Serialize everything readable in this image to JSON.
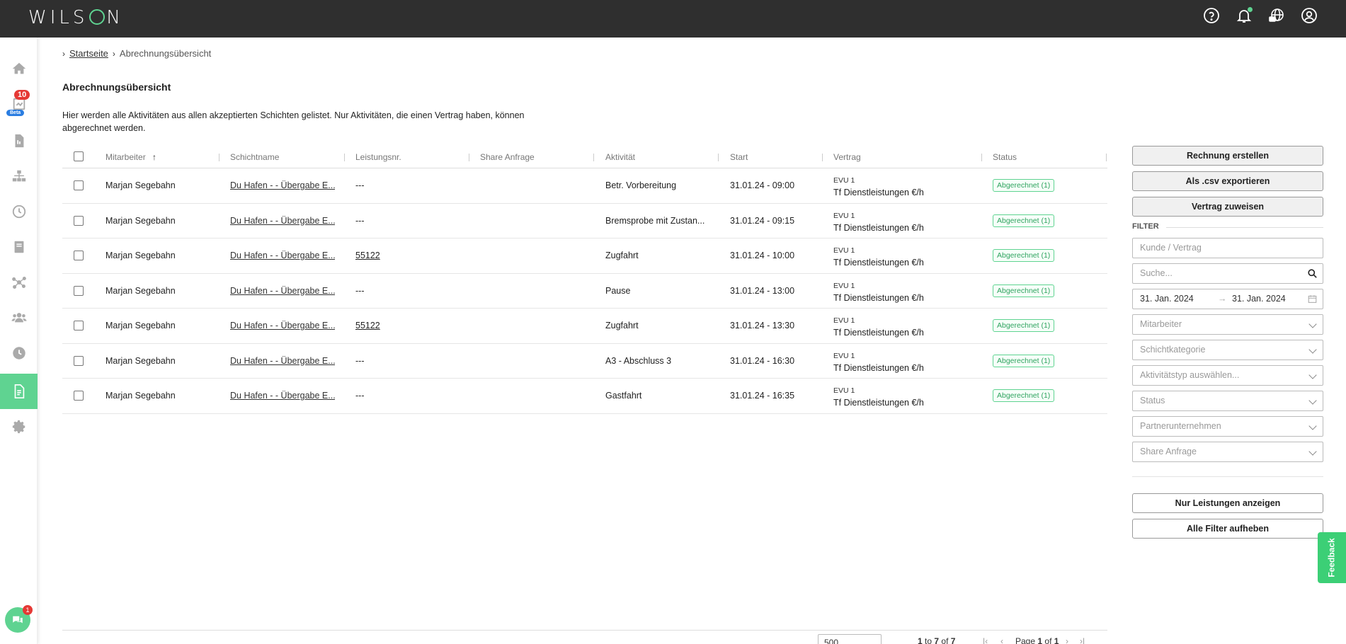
{
  "app": {
    "logo": "WILSON"
  },
  "topbar": {
    "icons": [
      "help-icon",
      "bell-icon",
      "globe-chat-icon",
      "user-account-icon"
    ]
  },
  "sidebar": {
    "items": [
      "home-icon",
      "report-icon",
      "document-icon",
      "hierarchy-icon",
      "clock-icon",
      "book-icon",
      "network-icon",
      "users-icon",
      "history-icon",
      "billing-icon",
      "gear-icon"
    ],
    "report_badge": "10",
    "beta_label": "Beta",
    "chat_badge": "1",
    "accent": "#5fd391"
  },
  "breadcrumb": {
    "home": "Startseite",
    "current": "Abrechnungsübersicht"
  },
  "page": {
    "title": "Abrechnungsübersicht",
    "description": "Hier werden alle Aktivitäten aus allen akzeptierten Schichten gelistet. Nur Aktivitäten, die einen Vertrag haben, können abgerechnet werden."
  },
  "table": {
    "columns": [
      "Mitarbeiter",
      "Schichtname",
      "Leistungsnr.",
      "Share Anfrage",
      "Aktivität",
      "Start",
      "Vertrag",
      "Status"
    ],
    "rows": [
      {
        "mitarbeiter": "Marjan Segebahn",
        "schicht": "Du Hafen - - Übergabe E...",
        "leistung": "---",
        "aktivitaet": "Betr. Vorbereitung",
        "start": "31.01.24 - 09:00",
        "evu": "EVU 1",
        "vertrag": "Tf Dienstleistungen €/h",
        "status": "Abgerechnet (1)"
      },
      {
        "mitarbeiter": "Marjan Segebahn",
        "schicht": "Du Hafen - - Übergabe E...",
        "leistung": "---",
        "aktivitaet": "Bremsprobe mit Zustan...",
        "start": "31.01.24 - 09:15",
        "evu": "EVU 1",
        "vertrag": "Tf Dienstleistungen €/h",
        "status": "Abgerechnet (1)"
      },
      {
        "mitarbeiter": "Marjan Segebahn",
        "schicht": "Du Hafen - - Übergabe E...",
        "leistung": "55122",
        "aktivitaet": "Zugfahrt",
        "start": "31.01.24 - 10:00",
        "evu": "EVU 1",
        "vertrag": "Tf Dienstleistungen €/h",
        "status": "Abgerechnet (1)"
      },
      {
        "mitarbeiter": "Marjan Segebahn",
        "schicht": "Du Hafen - - Übergabe E...",
        "leistung": "---",
        "aktivitaet": "Pause",
        "start": "31.01.24 - 13:00",
        "evu": "EVU 1",
        "vertrag": "Tf Dienstleistungen €/h",
        "status": "Abgerechnet (1)"
      },
      {
        "mitarbeiter": "Marjan Segebahn",
        "schicht": "Du Hafen - - Übergabe E...",
        "leistung": "55122",
        "aktivitaet": "Zugfahrt",
        "start": "31.01.24 - 13:30",
        "evu": "EVU 1",
        "vertrag": "Tf Dienstleistungen €/h",
        "status": "Abgerechnet (1)"
      },
      {
        "mitarbeiter": "Marjan Segebahn",
        "schicht": "Du Hafen - - Übergabe E...",
        "leistung": "---",
        "aktivitaet": "A3 - Abschluss 3",
        "start": "31.01.24 - 16:30",
        "evu": "EVU 1",
        "vertrag": "Tf Dienstleistungen €/h",
        "status": "Abgerechnet (1)"
      },
      {
        "mitarbeiter": "Marjan Segebahn",
        "schicht": "Du Hafen - - Übergabe E...",
        "leistung": "---",
        "aktivitaet": "Gastfahrt",
        "start": "31.01.24 - 16:35",
        "evu": "EVU 1",
        "vertrag": "Tf Dienstleistungen €/h",
        "status": "Abgerechnet (1)"
      }
    ]
  },
  "panel": {
    "btn_invoice": "Rechnung erstellen",
    "btn_csv": "Als .csv exportieren",
    "btn_contract": "Vertrag zuweisen",
    "filter_label": "FILTER",
    "customer_placeholder": "Kunde / Vertrag",
    "search_placeholder": "Suche...",
    "date_from": "31. Jan. 2024",
    "date_arrow": "→",
    "date_to": "31. Jan. 2024",
    "selects": [
      "Mitarbeiter",
      "Schichtkategorie",
      "Aktivitätstyp auswählen...",
      "Status",
      "Partnerunternehmen",
      "Share Anfrage"
    ],
    "btn_only_services": "Nur Leistungen anzeigen",
    "btn_clear": "Alle Filter aufheben"
  },
  "feedback": "Feedback",
  "pager": {
    "page_size": "500",
    "range_from": "1",
    "range_to": "7",
    "total": "7",
    "page_label": "Page",
    "page": "1",
    "pages": "1"
  }
}
